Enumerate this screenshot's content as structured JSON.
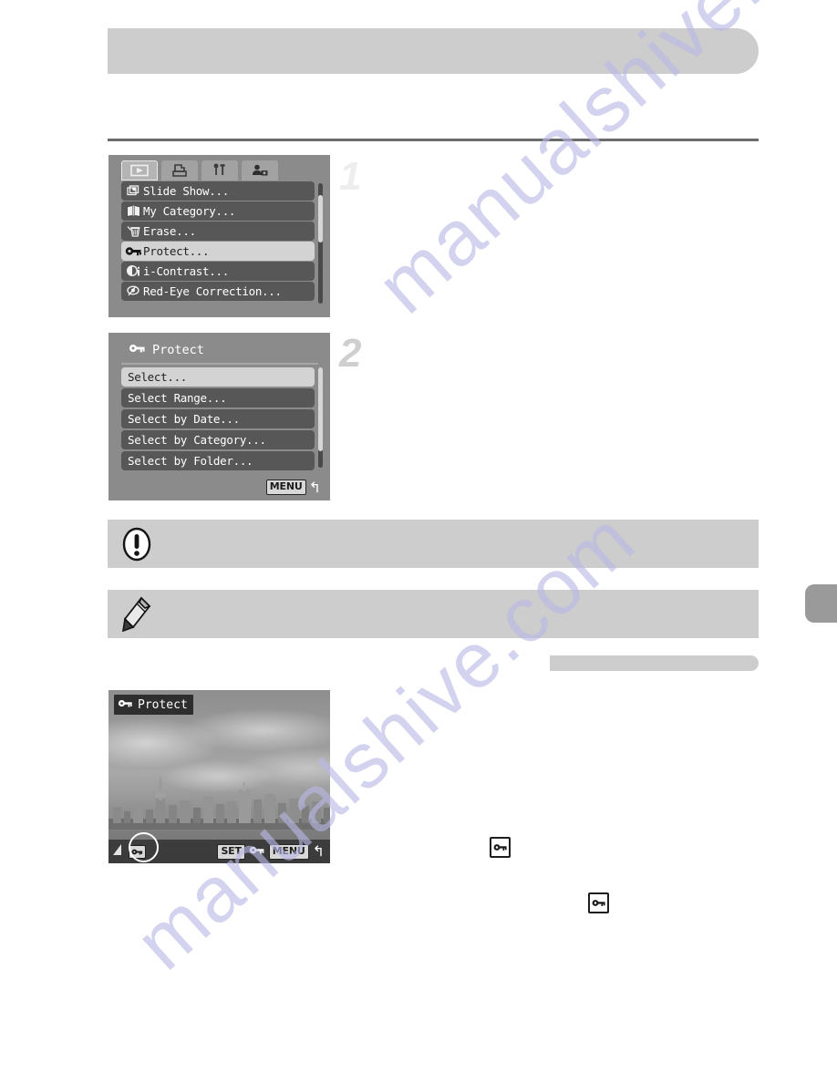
{
  "page": {
    "header_title": "",
    "section_subhead": "",
    "step_numbers": [
      "1",
      "2"
    ],
    "side_tab_label": ""
  },
  "screen_playback_menu": {
    "name": "Playback menu screen",
    "tabs": [
      {
        "label": "",
        "icon": "playback-tab-icon",
        "selected": true
      },
      {
        "label": "",
        "icon": "print-tab-icon",
        "selected": false
      },
      {
        "label": "",
        "icon": "settings-tab-icon",
        "selected": false
      },
      {
        "label": "",
        "icon": "my-camera-tab-icon",
        "selected": false
      }
    ],
    "items": [
      {
        "label": "Slide Show...",
        "icon": "slideshow-icon",
        "selected": false
      },
      {
        "label": "My Category...",
        "icon": "category-book-icon",
        "selected": false
      },
      {
        "label": "Erase...",
        "icon": "trash-icon",
        "selected": false
      },
      {
        "label": "Protect...",
        "icon": "key-icon",
        "selected": true
      },
      {
        "label": "i-Contrast...",
        "icon": "contrast-icon",
        "selected": false
      },
      {
        "label": "Red-Eye Correction...",
        "icon": "red-eye-icon",
        "selected": false
      }
    ]
  },
  "screen_protect_submenu": {
    "name": "Protect submenu screen",
    "title": "Protect",
    "title_icon": "key-icon",
    "items": [
      {
        "label": "Select...",
        "selected": true
      },
      {
        "label": "Select Range...",
        "selected": false
      },
      {
        "label": "Select by Date...",
        "selected": false
      },
      {
        "label": "Select by Category...",
        "selected": false
      },
      {
        "label": "Select by Folder...",
        "selected": false
      }
    ],
    "footer": {
      "button": "MENU",
      "return_glyph": "↰"
    }
  },
  "screen_protect_image": {
    "name": "Protect single image screen",
    "title": "Protect",
    "title_icon": "key-icon",
    "image_description": "",
    "bottom_bar": {
      "battery_icon": "battery-icon",
      "protect_toggle_icon": "key-box-icon",
      "set_button": "SET",
      "set_action_icon": "key-icon",
      "menu_button": "MENU",
      "return_glyph": "↰"
    },
    "highlight_annotation": "circle-highlight"
  },
  "callouts": [
    {
      "icon": "warning-exclamation-icon",
      "text": ""
    },
    {
      "icon": "note-pencil-icon",
      "text": ""
    }
  ],
  "inline_icons": [
    {
      "icon": "key-boxed-icon",
      "label": ""
    },
    {
      "icon": "key-boxed-icon",
      "label": ""
    }
  ],
  "watermark": {
    "line1": "manualshive.com",
    "line2": "manualshive.com"
  },
  "colors": {
    "page_background": "#ffffff",
    "bar_gray": "#cdcdcd",
    "rule_gray": "#6b6b6b",
    "screen_gray": "#8b8b8b",
    "menu_row_dark": "#575757",
    "menu_row_highlight": "#d3d3d3",
    "side_tab": "#9a9a9a",
    "watermark": "#b9b9e8"
  }
}
